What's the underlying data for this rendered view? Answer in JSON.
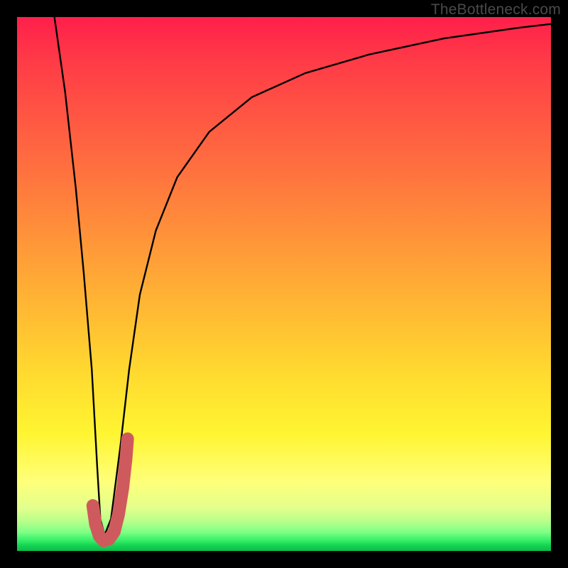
{
  "watermark": "TheBottleneck.com",
  "chart_data": {
    "type": "line",
    "title": "",
    "xlabel": "",
    "ylabel": "",
    "xlim": [
      0,
      100
    ],
    "ylim": [
      0,
      100
    ],
    "grid": false,
    "legend": false,
    "series": [
      {
        "name": "black-curve",
        "color": "#000000",
        "width": 2,
        "x": [
          7,
          9,
          11,
          12.5,
          14,
          15,
          15.6,
          16.4,
          17.6,
          19.4,
          21,
          23,
          26,
          30,
          36,
          44,
          54,
          66,
          80,
          94,
          100
        ],
        "y": [
          100,
          86,
          68,
          52,
          34,
          16,
          6,
          3,
          6,
          20,
          34,
          48,
          60,
          70,
          78.5,
          85,
          89.5,
          93,
          96,
          98,
          98.7
        ]
      },
      {
        "name": "red-marker-j",
        "color": "#cf5a5d",
        "width": 10,
        "linecap": "round",
        "x": [
          14.2,
          14.7,
          15.4,
          16.2,
          17.2,
          18.2,
          19.0,
          19.8,
          20.4,
          20.7
        ],
        "y": [
          8.5,
          5.0,
          2.8,
          1.9,
          2.2,
          3.6,
          6.8,
          11.8,
          17.2,
          21.0
        ]
      }
    ],
    "background_gradient_stops": [
      {
        "pos": 0.0,
        "color": "#ff1f4b"
      },
      {
        "pos": 0.48,
        "color": "#ffa636"
      },
      {
        "pos": 0.78,
        "color": "#fff531"
      },
      {
        "pos": 0.95,
        "color": "#b6ff8a"
      },
      {
        "pos": 1.0,
        "color": "#0dbb4a"
      }
    ]
  }
}
